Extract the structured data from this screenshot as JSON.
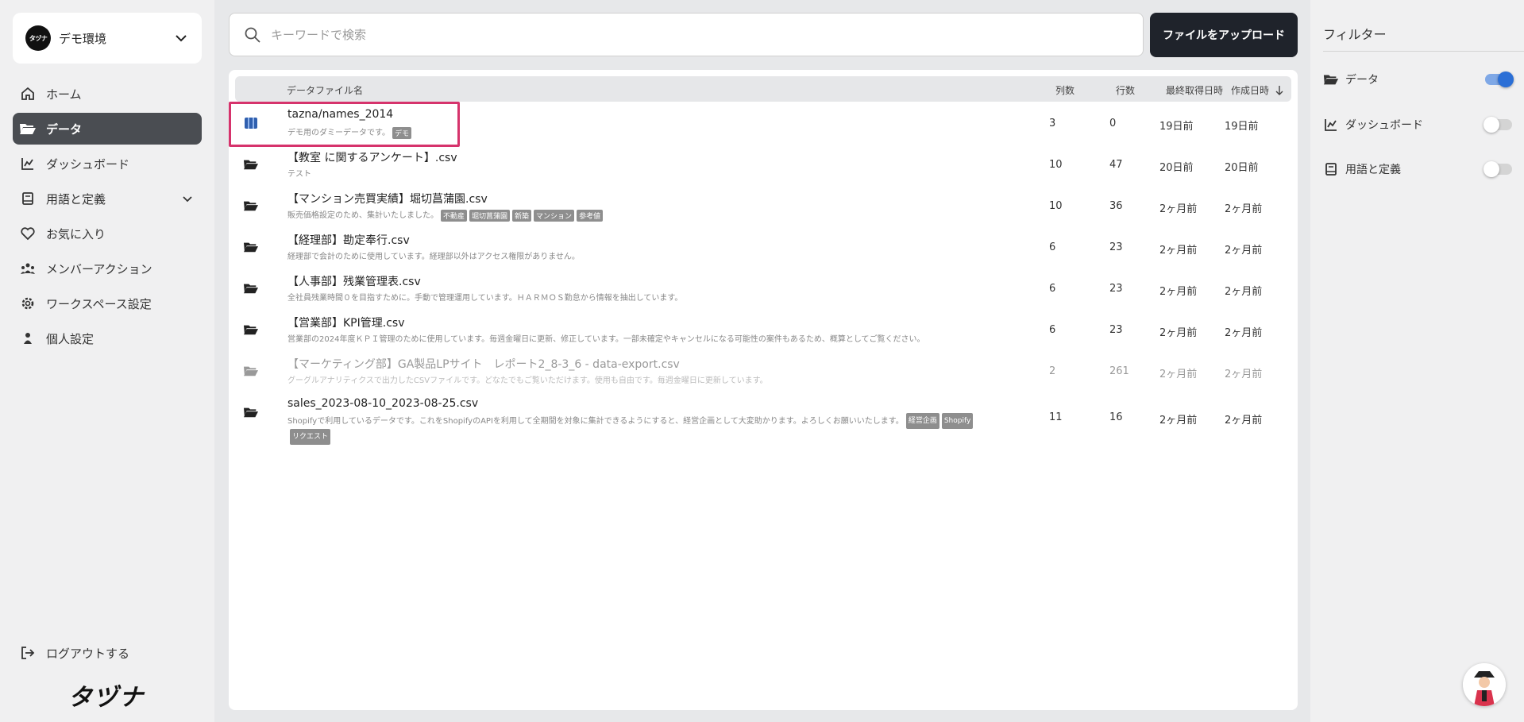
{
  "workspace": {
    "logo_text": "タヅナ",
    "name": "デモ環境"
  },
  "nav": {
    "items": [
      {
        "label": "ホーム"
      },
      {
        "label": "データ"
      },
      {
        "label": "ダッシュボード"
      },
      {
        "label": "用語と定義"
      },
      {
        "label": "お気に入り"
      },
      {
        "label": "メンバーアクション"
      },
      {
        "label": "ワークスペース設定"
      },
      {
        "label": "個人設定"
      }
    ],
    "logout": "ログアウトする",
    "brand": "タヅナ"
  },
  "search": {
    "placeholder": "キーワードで検索",
    "value": ""
  },
  "upload_label": "ファイルをアップロード",
  "table": {
    "headers": {
      "name": "データファイル名",
      "cols": "列数",
      "rows": "行数",
      "last": "最終取得日時",
      "created": "作成日時"
    },
    "rows": [
      {
        "title": "tazna/names_2014",
        "desc": "デモ用のダミーデータです。",
        "tags": [
          "デモ"
        ],
        "cols": "3",
        "rows": "0",
        "last": "19日前",
        "created": "19日前"
      },
      {
        "title": "【教室 に関するアンケート】.csv",
        "desc": "テスト",
        "tags": [],
        "cols": "10",
        "rows": "47",
        "last": "20日前",
        "created": "20日前"
      },
      {
        "title": "【マンション売買実績】堀切菖蒲園.csv",
        "desc": "販売価格設定のため、集計いたしました。",
        "tags": [
          "不動産",
          "堀切菖蒲園",
          "新築",
          "マンション",
          "参考値"
        ],
        "cols": "10",
        "rows": "36",
        "last": "2ヶ月前",
        "created": "2ヶ月前"
      },
      {
        "title": "【経理部】勘定奉行.csv",
        "desc": "経理部で会計のために使用しています。経理部以外はアクセス権限がありません。",
        "tags": [],
        "cols": "6",
        "rows": "23",
        "last": "2ヶ月前",
        "created": "2ヶ月前"
      },
      {
        "title": "【人事部】残業管理表.csv",
        "desc": "全社員残業時間０を目指すために。手動で管理運用しています。ＨＡＲＭＯＳ勤怠から情報を抽出しています。",
        "tags": [],
        "cols": "6",
        "rows": "23",
        "last": "2ヶ月前",
        "created": "2ヶ月前"
      },
      {
        "title": "【営業部】KPI管理.csv",
        "desc": "営業部の2024年度ＫＰＩ管理のために使用しています。毎週金曜日に更新、修正しています。一部未確定やキャンセルになる可能性の案件もあるため、概算としてご覧ください。",
        "tags": [],
        "cols": "6",
        "rows": "23",
        "last": "2ヶ月前",
        "created": "2ヶ月前"
      },
      {
        "title": "【マーケティング部】GA製品LPサイト　レポート2_8-3_6 - data-export.csv",
        "desc": "グーグルアナリティクスで出力したCSVファイルです。どなたでもご覧いただけます。使用も自由です。毎週金曜日に更新しています。",
        "tags": [],
        "cols": "2",
        "rows": "261",
        "last": "2ヶ月前",
        "created": "2ヶ月前"
      },
      {
        "title": "sales_2023-08-10_2023-08-25.csv",
        "desc": "Shopifyで利用しているデータです。これをShopifyのAPIを利用して全期間を対象に集計できるようにすると、経営企画として大変助かります。よろしくお願いいたします。",
        "tags": [
          "経営企画",
          "Shopify",
          "リクエスト"
        ],
        "cols": "11",
        "rows": "16",
        "last": "2ヶ月前",
        "created": "2ヶ月前"
      }
    ]
  },
  "filter": {
    "title": "フィルター",
    "items": [
      {
        "label": "データ",
        "on": true
      },
      {
        "label": "ダッシュボード",
        "on": false
      },
      {
        "label": "用語と定義",
        "on": false
      }
    ]
  },
  "colors": {
    "accent": "#2b6fd6",
    "highlight": "#d6336c",
    "nav_active": "#4a4d52",
    "button": "#1f232b"
  }
}
